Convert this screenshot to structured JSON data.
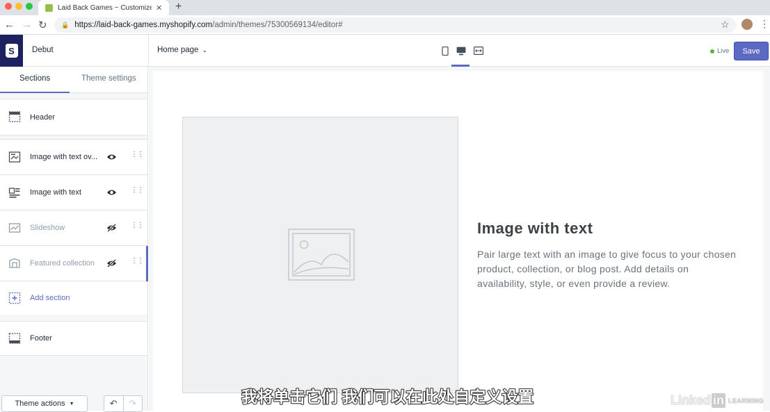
{
  "browser": {
    "tab_title": "Laid Back Games ~ Customize",
    "tab_close": "✕",
    "new_tab": "+",
    "url_host": "https://laid-back-games.myshopify.com",
    "url_path": "/admin/themes/75300569134/editor#"
  },
  "topbar": {
    "theme_name": "Debut",
    "page_selector": "Home page",
    "live_label": "Live",
    "save_label": "Save"
  },
  "sidebar": {
    "tabs": [
      {
        "label": "Sections",
        "active": true
      },
      {
        "label": "Theme settings",
        "active": false
      }
    ],
    "header_item": {
      "label": "Header",
      "icon": "header-layout-icon"
    },
    "items": [
      {
        "label": "Image with text ov...",
        "icon": "image-text-overlay-icon",
        "visible": true
      },
      {
        "label": "Image with text",
        "icon": "image-with-text-icon",
        "visible": true
      },
      {
        "label": "Slideshow",
        "icon": "slideshow-icon",
        "visible": false
      },
      {
        "label": "Featured collection",
        "icon": "featured-collection-icon",
        "visible": false
      }
    ],
    "add_section": "Add section",
    "footer_item": {
      "label": "Footer",
      "icon": "footer-layout-icon"
    },
    "theme_actions": "Theme actions"
  },
  "preview": {
    "heading": "Image with text",
    "body": "Pair large text with an image to give focus to your chosen product, collection, or blog post. Add details on availability, style, or even provide a review."
  },
  "overlay": {
    "subtitle": "我将单击它们 我们可以在此处自定义设置",
    "watermark_a": "Linked",
    "watermark_b": "in",
    "watermark_c": "LEARNING"
  },
  "colors": {
    "accent": "#5c6ac4",
    "live_dot": "#50b83c",
    "logo_bg": "#1c2260"
  }
}
